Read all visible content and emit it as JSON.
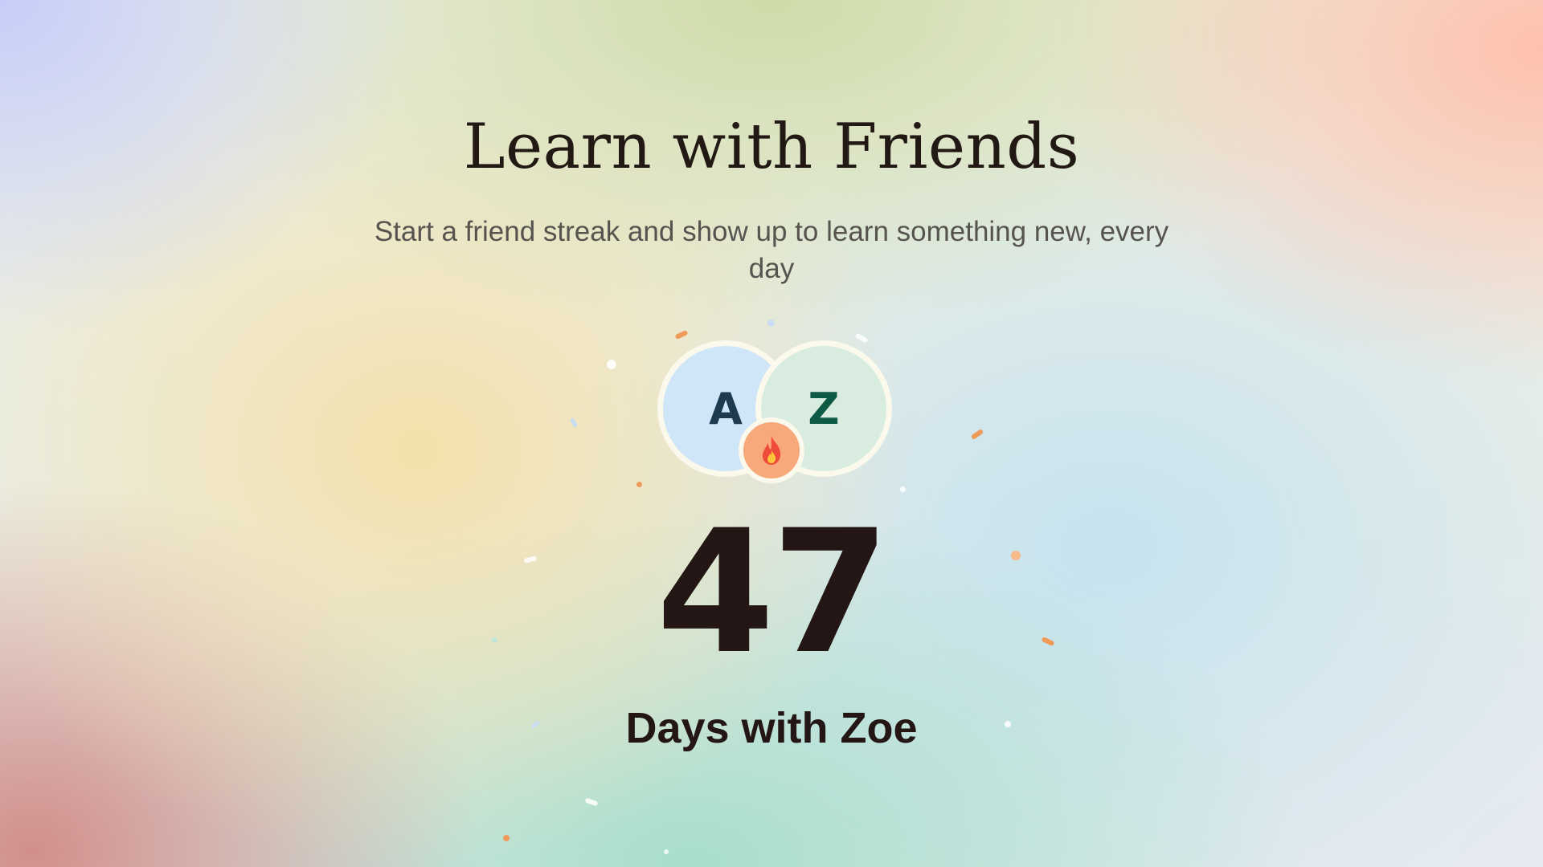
{
  "header": {
    "title": "Learn with Friends",
    "subtitle": "Start a friend streak and show up to learn something new, every day"
  },
  "streak": {
    "user_initial": "A",
    "friend_initial": "Z",
    "count": "47",
    "label": "Days with Zoe"
  },
  "icons": {
    "badge": "fire-icon"
  },
  "colors": {
    "user_avatar_bg": "#cfe5f8",
    "friend_avatar_bg": "#d8ecdf",
    "badge_bg": "#f8a97c",
    "flame_outer": "#ef4b3c",
    "flame_inner": "#ffc53a"
  }
}
